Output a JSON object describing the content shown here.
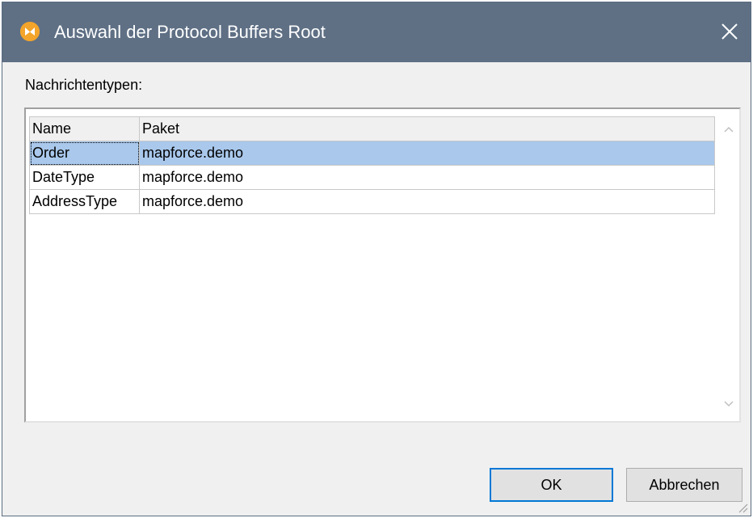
{
  "window": {
    "title": "Auswahl der Protocol Buffers Root",
    "icon": "mapforce-app-icon",
    "close_icon": "close-icon"
  },
  "main": {
    "label": "Nachrichtentypen:",
    "table": {
      "columns": [
        "Name",
        "Paket"
      ],
      "rows": [
        {
          "name": "Order",
          "package": "mapforce.demo",
          "selected": true
        },
        {
          "name": "DateType",
          "package": "mapforce.demo",
          "selected": false
        },
        {
          "name": "AddressType",
          "package": "mapforce.demo",
          "selected": false
        }
      ]
    }
  },
  "buttons": {
    "ok": "OK",
    "cancel": "Abbrechen"
  },
  "colors": {
    "titlebar": "#5f7085",
    "selection": "#a9c8ec",
    "default_button_border": "#0078d7"
  }
}
